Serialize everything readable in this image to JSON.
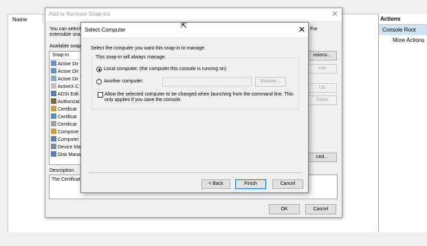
{
  "mmc": {
    "column_name": "Name",
    "actions_title": "Actions",
    "console_root": "Console Root",
    "more_actions": "More Actions"
  },
  "add_remove": {
    "title": "Add or Remove Snap-ins",
    "desc_line1": "You can select",
    "desc_line2": "extensible snap",
    "desc_right": "For",
    "available_label": "Available snap",
    "list_header": "Snap-in",
    "snapins": [
      {
        "label": "Active Dir",
        "color": "#6b8fc7"
      },
      {
        "label": "Active Dir",
        "color": "#6b8fc7"
      },
      {
        "label": "Active Dir",
        "color": "#8aa4cf"
      },
      {
        "label": "ActiveX C",
        "color": "#c0c0c0"
      },
      {
        "label": "ADSI Edit",
        "color": "#5b7fb5"
      },
      {
        "label": "Authorizat",
        "color": "#7a6a3a"
      },
      {
        "label": "Certificat",
        "color": "#c8a040"
      },
      {
        "label": "Certificat",
        "color": "#5b8fc7"
      },
      {
        "label": "Certificat",
        "color": "#a0a0a0"
      },
      {
        "label": "Compone",
        "color": "#c8a040"
      },
      {
        "label": "Computer",
        "color": "#5b7fb5"
      },
      {
        "label": "Device Ma",
        "color": "#7a8aa0"
      },
      {
        "label": "Disk Mana",
        "color": "#5b7fb5"
      }
    ],
    "buttons": {
      "extensions": "nsions...",
      "remove": "ove",
      "move_up": "Up",
      "move_down": "Down",
      "advanced": "ced...",
      "ok": "OK",
      "cancel": "Cancel"
    },
    "description_label": "Description:",
    "description_text": "The Certificat"
  },
  "select_computer": {
    "title": "Select Computer",
    "prompt": "Select the computer you want this snap-in to manage.",
    "group_label": "This snap-in will always manage:",
    "local_label": "Local computer:  (the computer this console is running on)",
    "local_selected": true,
    "another_label": "Another computer:",
    "another_value": "",
    "browse": "Browse...",
    "allow_change_line1": "Allow the selected computer to be changed when launching from the command line.  This",
    "allow_change_line2": "only applies if you save the console.",
    "allow_change_checked": false,
    "back": "< Back",
    "finish": "Finish",
    "cancel": "Cancel"
  }
}
